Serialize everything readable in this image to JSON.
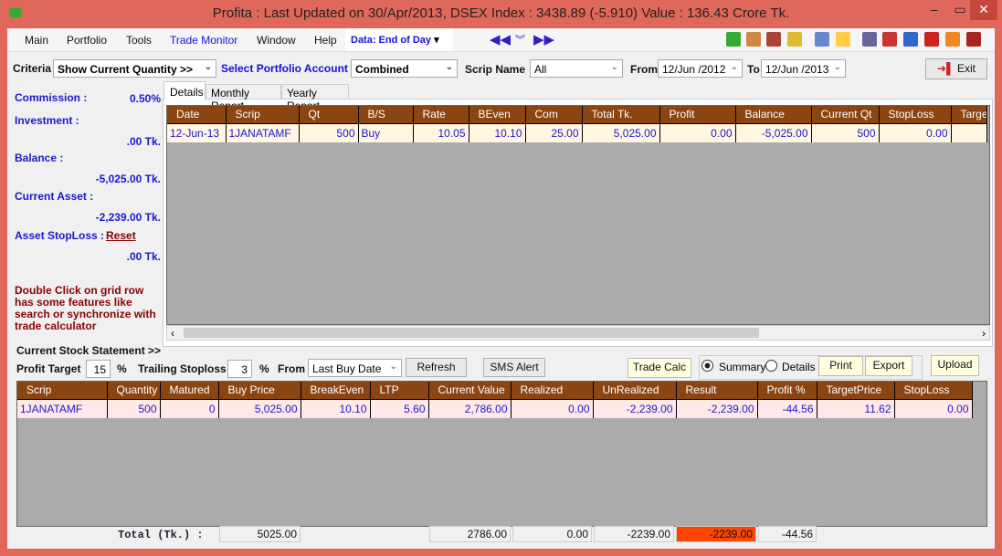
{
  "title": "Profita : Last Updated on 30/Apr/2013,  DSEX Index : 3438.89 (-5.910)  Value : 136.43 Crore Tk.",
  "menu": [
    "Main",
    "Portfolio",
    "Tools",
    "Trade Monitor",
    "Window",
    "Help"
  ],
  "data_mode": "Data: End of Day",
  "toolbar_icons": [
    "download-icon",
    "chart-icon",
    "bar-chart-icon",
    "export-icon",
    "edit-icon",
    "window-icon",
    "search-book-icon",
    "triangle-icon",
    "calculator-icon",
    "m-icon",
    "note-icon",
    "printer-icon"
  ],
  "criteria": {
    "label": "Criteria",
    "value": "Show Current Quantity >>",
    "account_label": "Select Portfolio Account",
    "account": "Combined",
    "scrip_label": "Scrip Name",
    "scrip": "All",
    "from_label": "From",
    "from": "12/Jun /2012",
    "to_label": "To",
    "to": "12/Jun /2013",
    "exit": "Exit"
  },
  "left": {
    "commission_label": "Commission :",
    "commission": "0.50%",
    "investment_label": "Investment :",
    "investment": ".00 Tk.",
    "balance_label": "Balance :",
    "balance": "-5,025.00 Tk.",
    "asset_label": "Current Asset :",
    "asset": "-2,239.00 Tk.",
    "stoploss_label": "Asset StopLoss :",
    "reset": "Reset",
    "stoploss": ".00 Tk.",
    "hint": "Double Click on grid row has some features like search or synchronize with trade calculator"
  },
  "tabs": [
    "Details",
    "Monthly Report",
    "Yearly Report"
  ],
  "details": {
    "columns": [
      "Date",
      "Scrip",
      "Qt",
      "B/S",
      "Rate",
      "BEven",
      "Com",
      "Total Tk.",
      "Profit",
      "Balance",
      "Current Qt",
      "StopLoss",
      "Target"
    ],
    "rows": [
      [
        "12-Jun-13",
        "1JANATAMF",
        "500",
        "Buy",
        "10.05",
        "10.10",
        "25.00",
        "5,025.00",
        "0.00",
        "-5,025.00",
        "500",
        "0.00",
        ""
      ]
    ]
  },
  "stock": {
    "title": "Current Stock Statement >>",
    "profit_target_label": "Profit Target",
    "profit_target": "15",
    "pct": "%",
    "trailing_label": "Trailing Stoploss",
    "trailing": "3",
    "from_label": "From",
    "from": "Last Buy Date",
    "refresh": "Refresh",
    "sms": "SMS Alert",
    "trade_calc": "Trade Calc",
    "summary": "Summary",
    "details": "Details",
    "view_selected": "Summary",
    "print": "Print",
    "export": "Export",
    "upload": "Upload",
    "columns": [
      "Scrip",
      "Quantity",
      "Matured",
      "Buy Price",
      "BreakEven",
      "LTP",
      "Current Value",
      "Realized",
      "UnRealized",
      "Result",
      "Profit %",
      "TargetPrice",
      "StopLoss"
    ],
    "rows": [
      [
        "1JANATAMF",
        "500",
        "0",
        "5,025.00",
        "10.10",
        "5.60",
        "2,786.00",
        "0.00",
        "-2,239.00",
        "-2,239.00",
        "-44.56",
        "11.62",
        "0.00"
      ]
    ],
    "total_label": "Total  (Tk.) :",
    "totals": {
      "buy_price": "5025.00",
      "current_value": "2786.00",
      "realized": "0.00",
      "unrealized": "-2239.00",
      "result": "-2239.00",
      "profit_pct": "-44.56"
    }
  },
  "colors": {
    "header": "#8B4513",
    "row_top": "#FFF5E1",
    "row_bottom": "#FFE8E8",
    "result_highlight": "#FF4500",
    "frame": "#E0685A"
  }
}
